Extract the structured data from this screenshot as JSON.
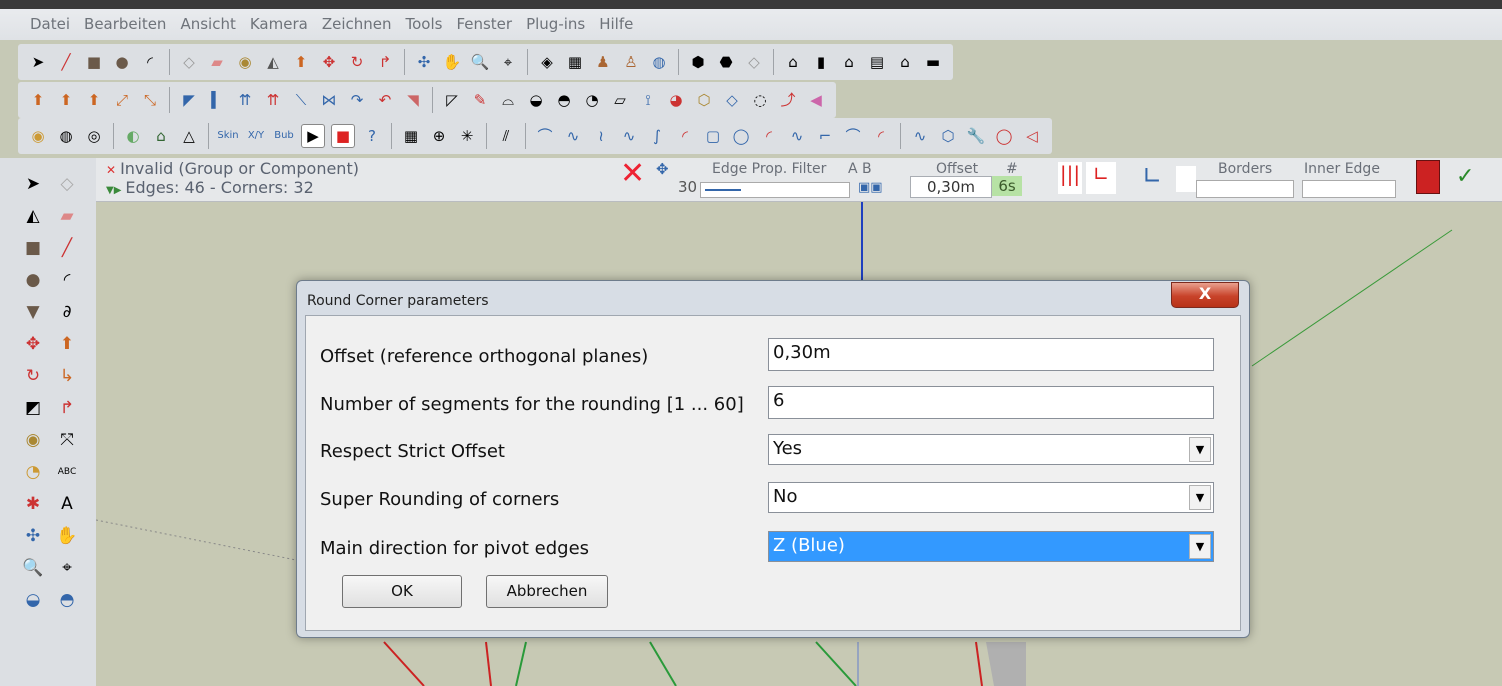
{
  "menu": [
    "Datei",
    "Bearbeiten",
    "Ansicht",
    "Kamera",
    "Zeichnen",
    "Tools",
    "Fenster",
    "Plug-ins",
    "Hilfe"
  ],
  "plugin_bar": {
    "status_line1": "Invalid (Group or Component)",
    "status_line2": "Edges: 46 - Corners: 32",
    "arrow_value": "30",
    "edge_prop_label": "Edge Prop. Filter",
    "ab_label": "A B",
    "offset_label": "Offset",
    "hash_label": "#",
    "offset_value": "0,30m",
    "segments_value": "6s",
    "borders_label": "Borders",
    "inner_edge_label": "Inner Edge"
  },
  "dialog": {
    "title": "Round Corner parameters",
    "close_label": "X",
    "fields": [
      {
        "label": "Offset (reference orthogonal planes)",
        "value": "0,30m"
      },
      {
        "label": "Number of segments for the rounding  [1 ... 60]",
        "value": "6"
      },
      {
        "label": "Respect Strict Offset",
        "value": "Yes"
      },
      {
        "label": "Super Rounding of corners",
        "value": "No"
      },
      {
        "label": "Main direction for pivot edges",
        "value": "Z (Blue)"
      }
    ],
    "ok_label": "OK",
    "cancel_label": "Abbrechen"
  },
  "colors": {
    "selection": "#3399ff",
    "close_button": "#c8432a",
    "viewport": "#c7c9b4"
  }
}
